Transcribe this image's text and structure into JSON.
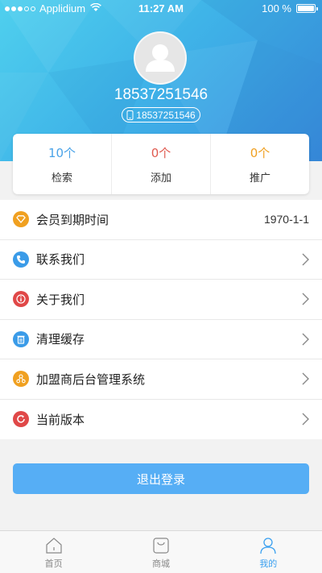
{
  "status_bar": {
    "carrier": "Applidium",
    "time": "11:27 AM",
    "battery": "100 %"
  },
  "profile": {
    "phone": "18537251546",
    "account_tag": "18537251546"
  },
  "stats": [
    {
      "count": "10个",
      "label": "检索",
      "color": "#4aa3e8"
    },
    {
      "count": "0个",
      "label": "添加",
      "color": "#e05a4f"
    },
    {
      "count": "0个",
      "label": "推广",
      "color": "#f0a020"
    }
  ],
  "menu": [
    {
      "label": "会员到期时间",
      "value": "1970-1-1",
      "icon": "diamond-icon",
      "color": "#f0a020"
    },
    {
      "label": "联系我们",
      "icon": "phone-icon",
      "color": "#3a9be8"
    },
    {
      "label": "关于我们",
      "icon": "info-icon",
      "color": "#e04848"
    },
    {
      "label": "清理缓存",
      "icon": "trash-icon",
      "color": "#3a9be8"
    },
    {
      "label": "加盟商后台管理系统",
      "icon": "network-icon",
      "color": "#f0a020"
    },
    {
      "label": "当前版本",
      "icon": "refresh-icon",
      "color": "#e04848"
    }
  ],
  "logout_label": "退出登录",
  "tabs": [
    {
      "label": "首页",
      "icon": "home-icon",
      "active": false
    },
    {
      "label": "商城",
      "icon": "shopping-bag-icon",
      "active": false
    },
    {
      "label": "我的",
      "icon": "user-icon",
      "active": true
    }
  ]
}
